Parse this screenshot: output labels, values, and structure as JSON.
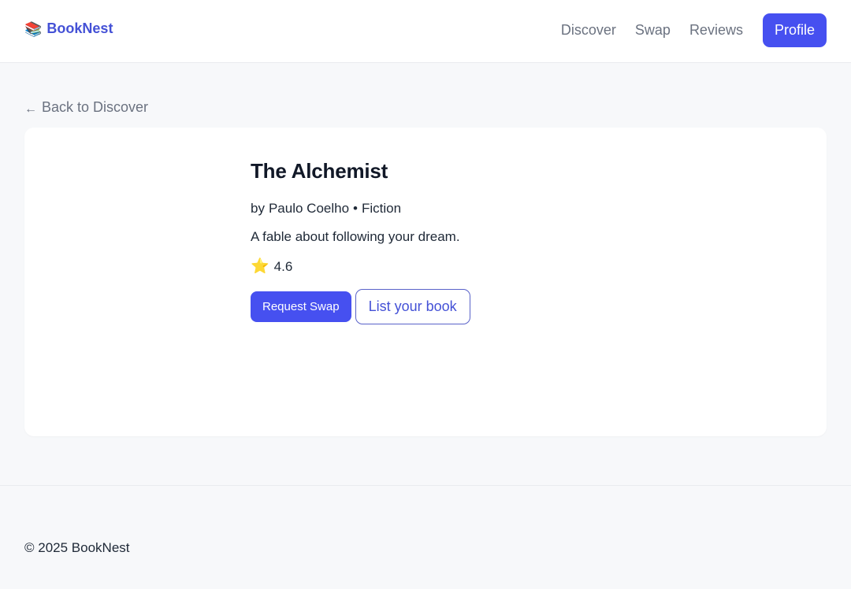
{
  "header": {
    "brand_icon": "📚",
    "brand_name": "BookNest",
    "nav": {
      "discover": "Discover",
      "swap": "Swap",
      "reviews": "Reviews",
      "profile": "Profile"
    }
  },
  "back_link": {
    "arrow": "←",
    "label": "Back to Discover"
  },
  "book": {
    "title": "The Alchemist",
    "by_prefix": "by",
    "author": "Paulo Coelho",
    "separator": "•",
    "genre": "Fiction",
    "description": "A fable about following your dream.",
    "rating_icon": "⭐",
    "rating": "4.6"
  },
  "actions": {
    "request_swap": "Request Swap",
    "list_book": "List your book"
  },
  "footer": {
    "copyright": "© 2025 BookNest"
  },
  "colors": {
    "accent": "#4650f0",
    "brand": "#4451d6",
    "star": "#f5b301"
  }
}
